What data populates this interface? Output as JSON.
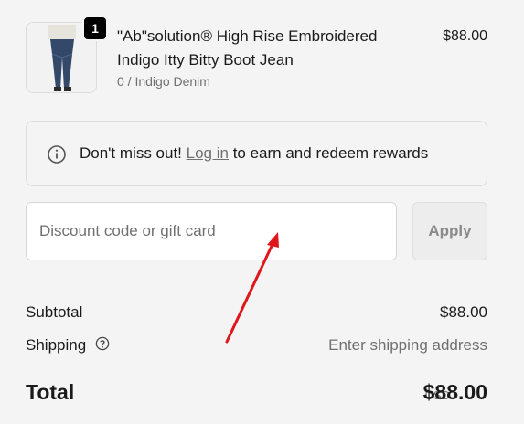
{
  "product": {
    "quantity": "1",
    "title": "\"Ab\"solution® High Rise Embroidered Indigo Itty Bitty Boot Jean",
    "variant": "0 / Indigo Denim",
    "price": "$88.00"
  },
  "rewards": {
    "prefix": "Don't miss out!",
    "link": "Log in",
    "suffix": "to earn and redeem rewards"
  },
  "discount": {
    "placeholder": "Discount code or gift card",
    "value": "",
    "apply_label": "Apply"
  },
  "summary": {
    "subtotal_label": "Subtotal",
    "subtotal_value": "$88.00",
    "shipping_label": "Shipping",
    "shipping_value": "Enter shipping address",
    "total_label": "Total",
    "currency": "USD",
    "total_value": "$88.00"
  },
  "colors": {
    "background": "#f4f4f4",
    "annotation_arrow": "#e0161b"
  },
  "icons": [
    "product-thumbnail",
    "info-icon",
    "question-circle-icon",
    "red-arrow-annotation"
  ]
}
